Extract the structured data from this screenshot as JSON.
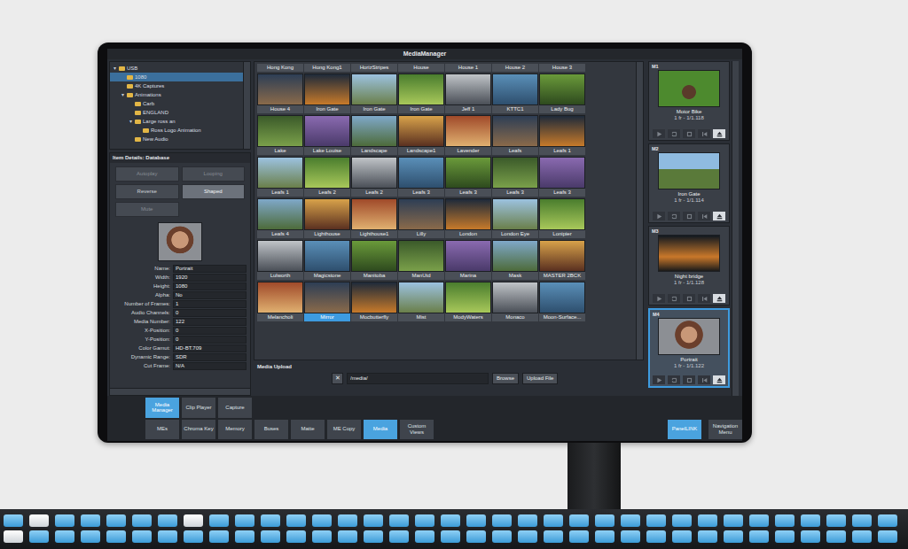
{
  "window": {
    "title": "MediaManager"
  },
  "tree": [
    {
      "label": "USB",
      "toggle": "▾",
      "depth": 0,
      "selected": false
    },
    {
      "label": "1080",
      "depth": 1,
      "selected": true
    },
    {
      "label": "4K Captures",
      "depth": 1,
      "selected": false
    },
    {
      "label": "Animations",
      "toggle": "▾",
      "depth": 1,
      "selected": false
    },
    {
      "label": "Carb",
      "depth": 2,
      "selected": false
    },
    {
      "label": "ENGLAND",
      "depth": 2,
      "selected": false
    },
    {
      "label": "Large ross an",
      "toggle": "▾",
      "depth": 2,
      "selected": false
    },
    {
      "label": "Ross Logo Animation",
      "depth": 3,
      "selected": false
    },
    {
      "label": "New Audio",
      "depth": 2,
      "selected": false
    }
  ],
  "details": {
    "title": "Item Details: Database",
    "buttons": [
      {
        "label": "Autoplay",
        "on": false,
        "disabled": true
      },
      {
        "label": "Looping",
        "on": false,
        "disabled": true
      },
      {
        "label": "Reverse",
        "on": false,
        "disabled": false
      },
      {
        "label": "Shaped",
        "on": true,
        "disabled": false
      },
      {
        "label": "Mute",
        "on": false,
        "disabled": true
      }
    ],
    "fields": [
      {
        "label": "Name:",
        "value": "Portrait"
      },
      {
        "label": "Width:",
        "value": "1920"
      },
      {
        "label": "Height:",
        "value": "1080"
      },
      {
        "label": "Alpha:",
        "value": "No"
      },
      {
        "label": "Number of Frames:",
        "value": "1"
      },
      {
        "label": "Audio Channels:",
        "value": "0"
      },
      {
        "label": "Media Number:",
        "value": "122"
      },
      {
        "label": "X-Position:",
        "value": "0"
      },
      {
        "label": "Y-Position:",
        "value": "0"
      },
      {
        "label": "Color Gamut:",
        "value": "HD-BT.709"
      },
      {
        "label": "Dynamic Range:",
        "value": "SDR"
      },
      {
        "label": "Cut Frame:",
        "value": "N/A"
      }
    ]
  },
  "grid": {
    "header": [
      "Hong Kong",
      "Hong Kong1",
      "HorizStripes",
      "House",
      "House 1",
      "House 2",
      "House 3"
    ],
    "items": [
      {
        "label": "House 4",
        "selected": false
      },
      {
        "label": "Iron Gate",
        "selected": false
      },
      {
        "label": "Iron Gate",
        "selected": false
      },
      {
        "label": "Iron Gate",
        "selected": false
      },
      {
        "label": "Jeff 1",
        "selected": false
      },
      {
        "label": "KTTC1",
        "selected": false
      },
      {
        "label": "Lady Bug",
        "selected": false
      },
      {
        "label": "Lake",
        "selected": false
      },
      {
        "label": "Lake Louise",
        "selected": false
      },
      {
        "label": "Landscape",
        "selected": false
      },
      {
        "label": "Landscape1",
        "selected": false
      },
      {
        "label": "Lavender",
        "selected": false
      },
      {
        "label": "Leafs",
        "selected": false
      },
      {
        "label": "Leafs 1",
        "selected": false
      },
      {
        "label": "Leafs 1",
        "selected": false
      },
      {
        "label": "Leafs 2",
        "selected": false
      },
      {
        "label": "Leafs 2",
        "selected": false
      },
      {
        "label": "Leafs 3",
        "selected": false
      },
      {
        "label": "Leafs 3",
        "selected": false
      },
      {
        "label": "Leafs 3",
        "selected": false
      },
      {
        "label": "Leafs 3",
        "selected": false
      },
      {
        "label": "Leafs 4",
        "selected": false
      },
      {
        "label": "Lighthouse",
        "selected": false
      },
      {
        "label": "Lighthouse1",
        "selected": false
      },
      {
        "label": "Lilly",
        "selected": false
      },
      {
        "label": "London",
        "selected": false
      },
      {
        "label": "London Eye",
        "selected": false
      },
      {
        "label": "Lonipier",
        "selected": false
      },
      {
        "label": "Lulworth",
        "selected": false
      },
      {
        "label": "Magicstone",
        "selected": false
      },
      {
        "label": "Manitoba",
        "selected": false
      },
      {
        "label": "ManUtd",
        "selected": false
      },
      {
        "label": "Marina",
        "selected": false
      },
      {
        "label": "Mask",
        "selected": false
      },
      {
        "label": "MASTER 2BCK",
        "selected": false
      },
      {
        "label": "Melancholi",
        "selected": false
      },
      {
        "label": "Mirror",
        "selected": true
      },
      {
        "label": "Mocbutterfly",
        "selected": false
      },
      {
        "label": "Mist",
        "selected": false
      },
      {
        "label": "ModyWaters",
        "selected": false
      },
      {
        "label": "Monaco",
        "selected": false
      },
      {
        "label": "Moon-Surface...",
        "selected": false
      }
    ]
  },
  "upload": {
    "title": "Media Upload",
    "clear": "✕",
    "path": "/media/",
    "browse": "Browse",
    "submit": "Upload File"
  },
  "channels": [
    {
      "id": "M1",
      "name": "Motor Bike",
      "info": "1 fr - 1/1.118",
      "selected": false
    },
    {
      "id": "M2",
      "name": "Iron Gate",
      "info": "1 fr - 1/1.114",
      "selected": false
    },
    {
      "id": "M3",
      "name": "Night bridge",
      "info": "1 fr - 1/1.128",
      "selected": false
    },
    {
      "id": "M4",
      "name": "Portrait",
      "info": "1 fr - 1/1.122",
      "selected": true
    }
  ],
  "subtabs": [
    {
      "label": "Media Manager",
      "selected": true
    },
    {
      "label": "Clip Player",
      "selected": false
    },
    {
      "label": "Capture",
      "selected": false
    }
  ],
  "nav": [
    {
      "label": "MEs",
      "selected": false
    },
    {
      "label": "Chroma Key",
      "selected": false
    },
    {
      "label": "Memory",
      "selected": false
    },
    {
      "label": "Buses",
      "selected": false
    },
    {
      "label": "Matte",
      "selected": false
    },
    {
      "label": "ME Copy",
      "selected": false
    },
    {
      "label": "Media",
      "selected": true
    },
    {
      "label": "Custom Views",
      "selected": false
    }
  ],
  "side_buttons": [
    {
      "label": "PanelLINK",
      "selected": true
    },
    {
      "label": "Navigation Menu",
      "selected": false
    }
  ]
}
